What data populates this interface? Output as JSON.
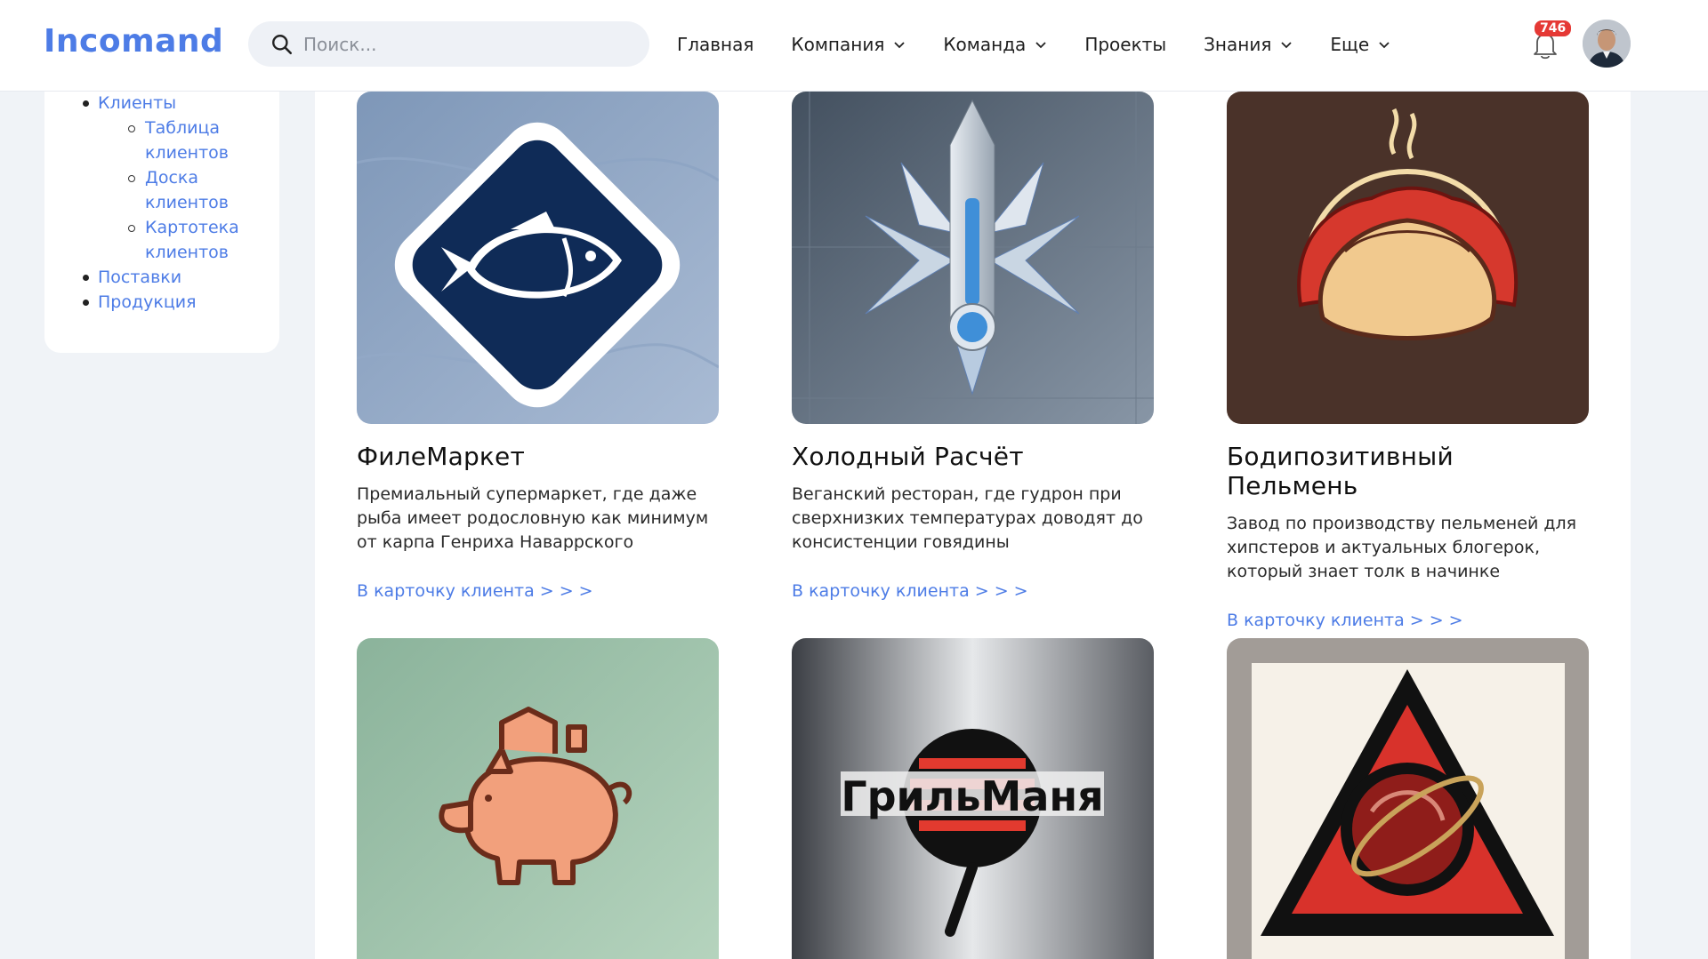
{
  "header": {
    "logo_text": "Incomand",
    "search": {
      "placeholder": "Поиск..."
    },
    "nav": [
      {
        "label": "Главная",
        "has_dropdown": false
      },
      {
        "label": "Компания",
        "has_dropdown": true
      },
      {
        "label": "Команда",
        "has_dropdown": true
      },
      {
        "label": "Проекты",
        "has_dropdown": false
      },
      {
        "label": "Знания",
        "has_dropdown": true
      },
      {
        "label": "Еще",
        "has_dropdown": true
      }
    ],
    "notifications_count": "746",
    "accent_color": "#4d7ce6",
    "badge_color": "#e53935"
  },
  "sidebar": {
    "items": [
      {
        "label": "Клиенты",
        "children": [
          {
            "label": "Таблица клиентов"
          },
          {
            "label": "Доска клиентов"
          },
          {
            "label": "Картотека клиентов"
          }
        ]
      },
      {
        "label": "Поставки"
      },
      {
        "label": "Продукция"
      }
    ]
  },
  "cards": [
    {
      "title": "ФилеМаркет",
      "description": "Премиальный супермаркет, где даже рыба имеет родословную как минимум от карпа Генриха Наваррского",
      "link": "В карточку клиента > > >",
      "image": "fish-logo-icon"
    },
    {
      "title": "Холодный Расчёт",
      "description": "Веганский ресторан, где гудрон при сверхнизких температурах доводят до консистенции говядины",
      "link": "В карточку клиента > > >",
      "image": "thermometer-logo-icon"
    },
    {
      "title": "Бодипозитивный Пельмень",
      "description": "Завод по производству пельменей для хипстеров и актуальных блогерок, который знает толк в начинке",
      "link": "В карточку клиента > > >",
      "image": "dumpling-logo-icon"
    },
    {
      "image": "pig-logo-icon"
    },
    {
      "image": "grill-logo-icon",
      "logo_text": "ГрильМаня"
    },
    {
      "image": "meat-triangle-logo-icon"
    }
  ]
}
